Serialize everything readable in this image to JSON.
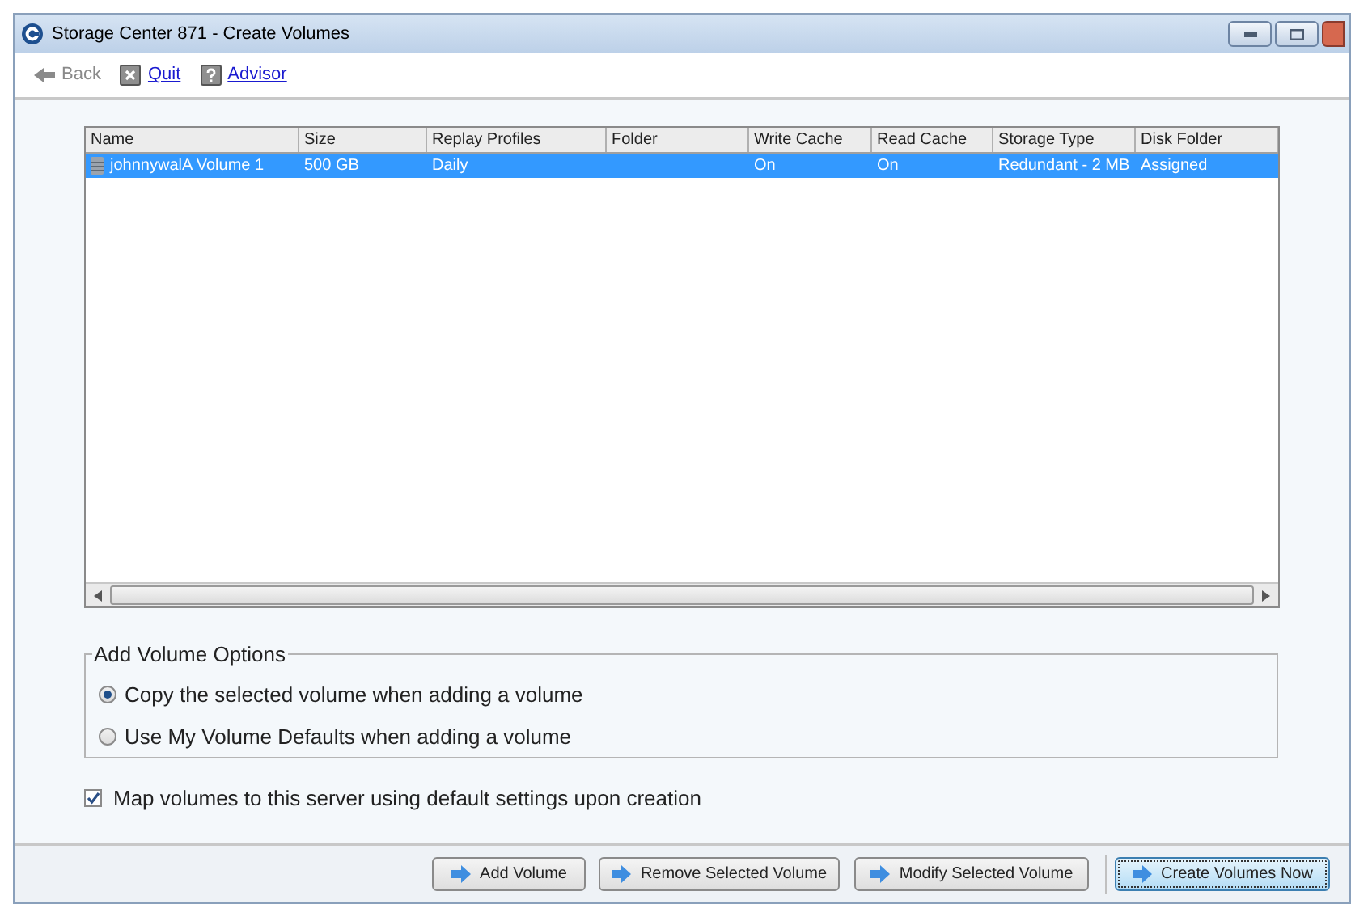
{
  "window": {
    "title": "Storage Center 871 - Create Volumes"
  },
  "toolbar": [
    {
      "kind": "back",
      "label": "Back",
      "disabled": true
    },
    {
      "kind": "quit",
      "label": "Quit",
      "disabled": false
    },
    {
      "kind": "advisor",
      "label": "Advisor",
      "disabled": false
    }
  ],
  "table": {
    "columns": [
      "Name",
      "Size",
      "Replay Profiles",
      "Folder",
      "Write Cache",
      "Read Cache",
      "Storage Type",
      "Disk Folder"
    ],
    "rows": [
      {
        "selected": true,
        "cells": [
          "johnnywalA Volume 1",
          "500 GB",
          "Daily",
          "",
          "On",
          "On",
          "Redundant - 2 MB",
          "Assigned"
        ]
      }
    ]
  },
  "options": {
    "title": "Add Volume Options",
    "radios": [
      {
        "label": "Copy the selected volume when adding a volume",
        "selected": true
      },
      {
        "label": "Use My Volume Defaults when adding a volume",
        "selected": false
      }
    ]
  },
  "map_checkbox": {
    "label": "Map volumes to this server using default settings upon creation",
    "checked": true
  },
  "buttons": [
    {
      "label": "Add Volume",
      "focused": false
    },
    {
      "label": "Remove Selected Volume",
      "focused": false
    },
    {
      "label": "Modify Selected Volume",
      "focused": false
    },
    {
      "label": "Create Volumes Now",
      "focused": true
    }
  ]
}
